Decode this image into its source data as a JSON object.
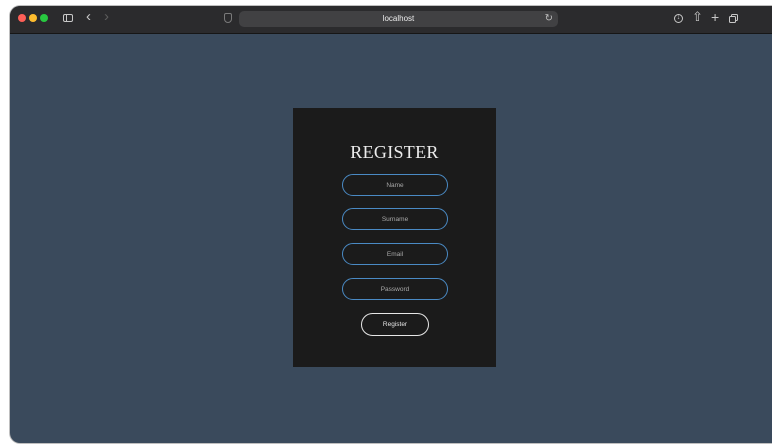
{
  "browser": {
    "url": "localhost",
    "icons": {
      "sidebar": "sidebar-icon",
      "back": "chevron-left-icon",
      "forward": "chevron-right-icon",
      "privacy": "shield-icon",
      "reload": "reload-icon",
      "download": "download-icon",
      "share": "share-icon",
      "new_tab": "plus-icon",
      "tab_overview": "tabs-icon"
    }
  },
  "form": {
    "title": "REGISTER",
    "fields": [
      {
        "placeholder": "Name",
        "value": ""
      },
      {
        "placeholder": "Surname",
        "value": ""
      },
      {
        "placeholder": "Email",
        "value": ""
      },
      {
        "placeholder": "Password",
        "value": ""
      }
    ],
    "submit_label": "Register"
  },
  "colors": {
    "page_background": "#3a4a5c",
    "card_background": "#1b1b1b",
    "field_border": "#4a8ac4",
    "button_border": "#e6e6e6"
  }
}
